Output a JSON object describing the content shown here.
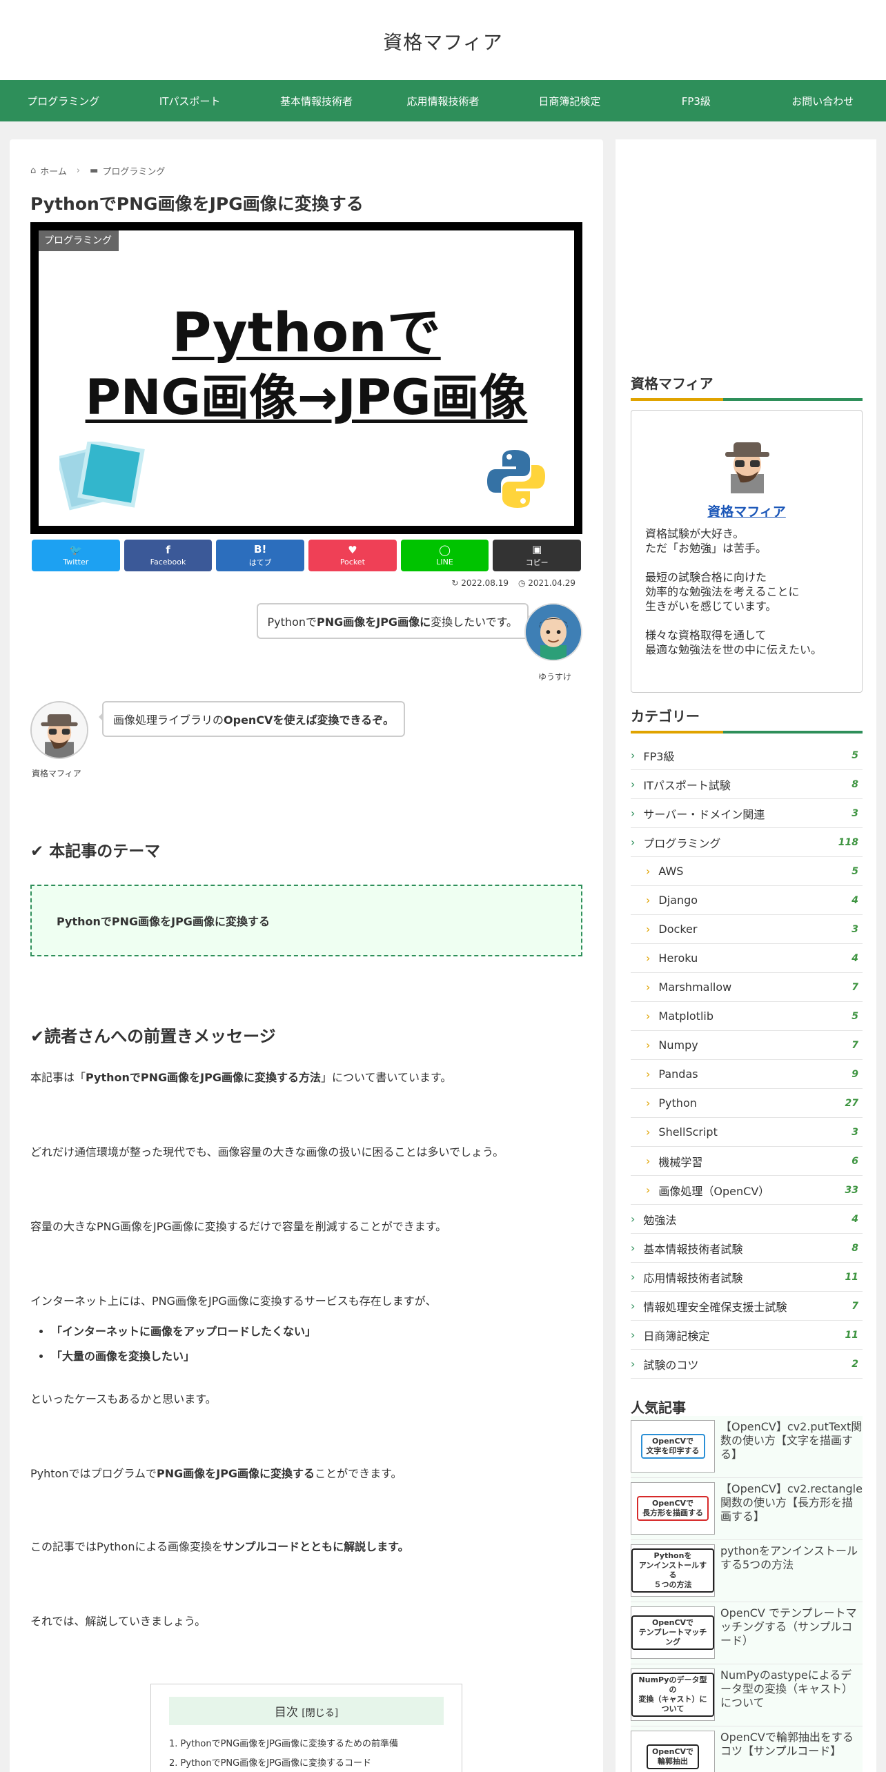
{
  "site": {
    "title": "資格マフィア"
  },
  "nav": [
    "プログラミング",
    "ITパスポート",
    "基本情報技術者",
    "応用情報技術者",
    "日商簿記検定",
    "FP3級",
    "お問い合わせ"
  ],
  "breadcrumb": {
    "home": "ホーム",
    "category": "プログラミング"
  },
  "post": {
    "title": "PythonでPNG画像をJPG画像に変換する",
    "eyecatch_category": "プログラミング",
    "eyecatch_line1": "Pythonで",
    "eyecatch_line2": "PNG画像→JPG画像",
    "date_updated": "2022.08.19",
    "date_published": "2021.04.29"
  },
  "share": [
    {
      "icon": "t",
      "label": "Twitter",
      "color": "#1da1f2"
    },
    {
      "icon": "f",
      "label": "Facebook",
      "color": "#3b5998"
    },
    {
      "icon": "B!",
      "label": "はてブ",
      "color": "#2c6ebd"
    },
    {
      "icon": "♥",
      "label": "Pocket",
      "color": "#ef4056"
    },
    {
      "icon": "◯",
      "label": "LINE",
      "color": "#00c300"
    },
    {
      "icon": "▣",
      "label": "コピー",
      "color": "#333333"
    }
  ],
  "chat": {
    "right_text_a": "Pythonで",
    "right_text_b": "PNG画像をJPG画像に",
    "right_text_c": "変換したいです。",
    "right_name": "ゆうすけ",
    "left_text_a": "画像処理ライブラリの",
    "left_text_b": "OpenCVを使えば変換できるぞ。",
    "left_name": "資格マフィア"
  },
  "sections": {
    "theme_heading": "✔ 本記事のテーマ",
    "theme_box": "PythonでPNG画像をJPG画像に変換する",
    "intro_heading": "✔読者さんへの前置きメッセージ"
  },
  "body": {
    "p1_a": "本記事は「",
    "p1_b": "PythonでPNG画像をJPG画像に変換する方法",
    "p1_c": "」について書いています。",
    "p2": "どれだけ通信環境が整った現代でも、画像容量の大きな画像の扱いに困ることは多いでしょう。",
    "p3": "容量の大きなPNG画像をJPG画像に変換するだけで容量を削減することができます。",
    "p4": "インターネット上には、PNG画像をJPG画像に変換するサービスも存在しますが、",
    "bullets": [
      "「インターネットに画像をアップロードしたくない」",
      "「大量の画像を変換したい」"
    ],
    "p5": "といったケースもあるかと思います。",
    "p6_a": "Pyhtonではプログラムで",
    "p6_b": "PNG画像をJPG画像に変換する",
    "p6_c": "ことができます。",
    "p7_a": "この記事ではPythonによる画像変換を",
    "p7_b": "サンプルコードとともに解説します。",
    "p8": "それでは、解説していきましょう。"
  },
  "toc": {
    "title": "目次",
    "toggle": "[閉じる]",
    "items": [
      "1. PythonでPNG画像をJPG画像に変換するための前準備",
      "2. PythonでPNG画像をJPG画像に変換するコード"
    ]
  },
  "sidebar": {
    "profile_title": "資格マフィア",
    "profile_name": "資格マフィア",
    "profile_lines": [
      "資格試験が大好き。",
      "ただ「お勉強」は苦手。",
      "",
      "最短の試験合格に向けた",
      "効率的な勉強法を考えることに",
      "生きがいを感じています。",
      "",
      "様々な資格取得を通して",
      "最適な勉強法を世の中に伝えたい。"
    ],
    "category_title": "カテゴリー",
    "categories": [
      {
        "label": "FP3級",
        "count": "5",
        "sub": false
      },
      {
        "label": "ITパスポート試験",
        "count": "8",
        "sub": false
      },
      {
        "label": "サーバー・ドメイン関連",
        "count": "3",
        "sub": false
      },
      {
        "label": "プログラミング",
        "count": "118",
        "sub": false
      },
      {
        "label": "AWS",
        "count": "5",
        "sub": true
      },
      {
        "label": "Django",
        "count": "4",
        "sub": true
      },
      {
        "label": "Docker",
        "count": "3",
        "sub": true
      },
      {
        "label": "Heroku",
        "count": "4",
        "sub": true
      },
      {
        "label": "Marshmallow",
        "count": "7",
        "sub": true
      },
      {
        "label": "Matplotlib",
        "count": "5",
        "sub": true
      },
      {
        "label": "Numpy",
        "count": "7",
        "sub": true
      },
      {
        "label": "Pandas",
        "count": "9",
        "sub": true
      },
      {
        "label": "Python",
        "count": "27",
        "sub": true
      },
      {
        "label": "ShellScript",
        "count": "3",
        "sub": true
      },
      {
        "label": "機械学習",
        "count": "6",
        "sub": true
      },
      {
        "label": "画像処理（OpenCV）",
        "count": "33",
        "sub": true
      },
      {
        "label": "勉強法",
        "count": "4",
        "sub": false
      },
      {
        "label": "基本情報技術者試験",
        "count": "8",
        "sub": false
      },
      {
        "label": "応用情報技術者試験",
        "count": "11",
        "sub": false
      },
      {
        "label": "情報処理安全確保支援士試験",
        "count": "7",
        "sub": false
      },
      {
        "label": "日商簿記検定",
        "count": "11",
        "sub": false
      },
      {
        "label": "試験のコツ",
        "count": "2",
        "sub": false
      }
    ],
    "popular_title": "人気記事",
    "popular": [
      {
        "thumb": "OpenCVで\n文字を印字する",
        "thumb_color": "#2a8fd6",
        "text": "【OpenCV】cv2.putText関数の使い方【文字を描画する】"
      },
      {
        "thumb": "OpenCVで\n長方形を描画する",
        "thumb_color": "#d62a2a",
        "text": "【OpenCV】cv2.rectangle関数の使い方【長方形を描画する】"
      },
      {
        "thumb": "Pythonを\nアンインストールする\n５つの方法",
        "thumb_color": "#222222",
        "text": "pythonをアンインストールする5つの方法"
      },
      {
        "thumb": "OpenCVで\nテンプレートマッチング",
        "thumb_color": "#222222",
        "text": "OpenCV でテンプレートマッチングする（サンプルコード）"
      },
      {
        "thumb": "NumPyのデータ型の\n変換（キャスト）について",
        "thumb_color": "#222222",
        "text": "NumPyのastypeによるデータ型の変換（キャスト）について"
      },
      {
        "thumb": "OpenCVで\n輪郭抽出",
        "thumb_color": "#222222",
        "text": "OpenCVで輪郭抽出をするコツ【サンプルコード】"
      }
    ]
  }
}
